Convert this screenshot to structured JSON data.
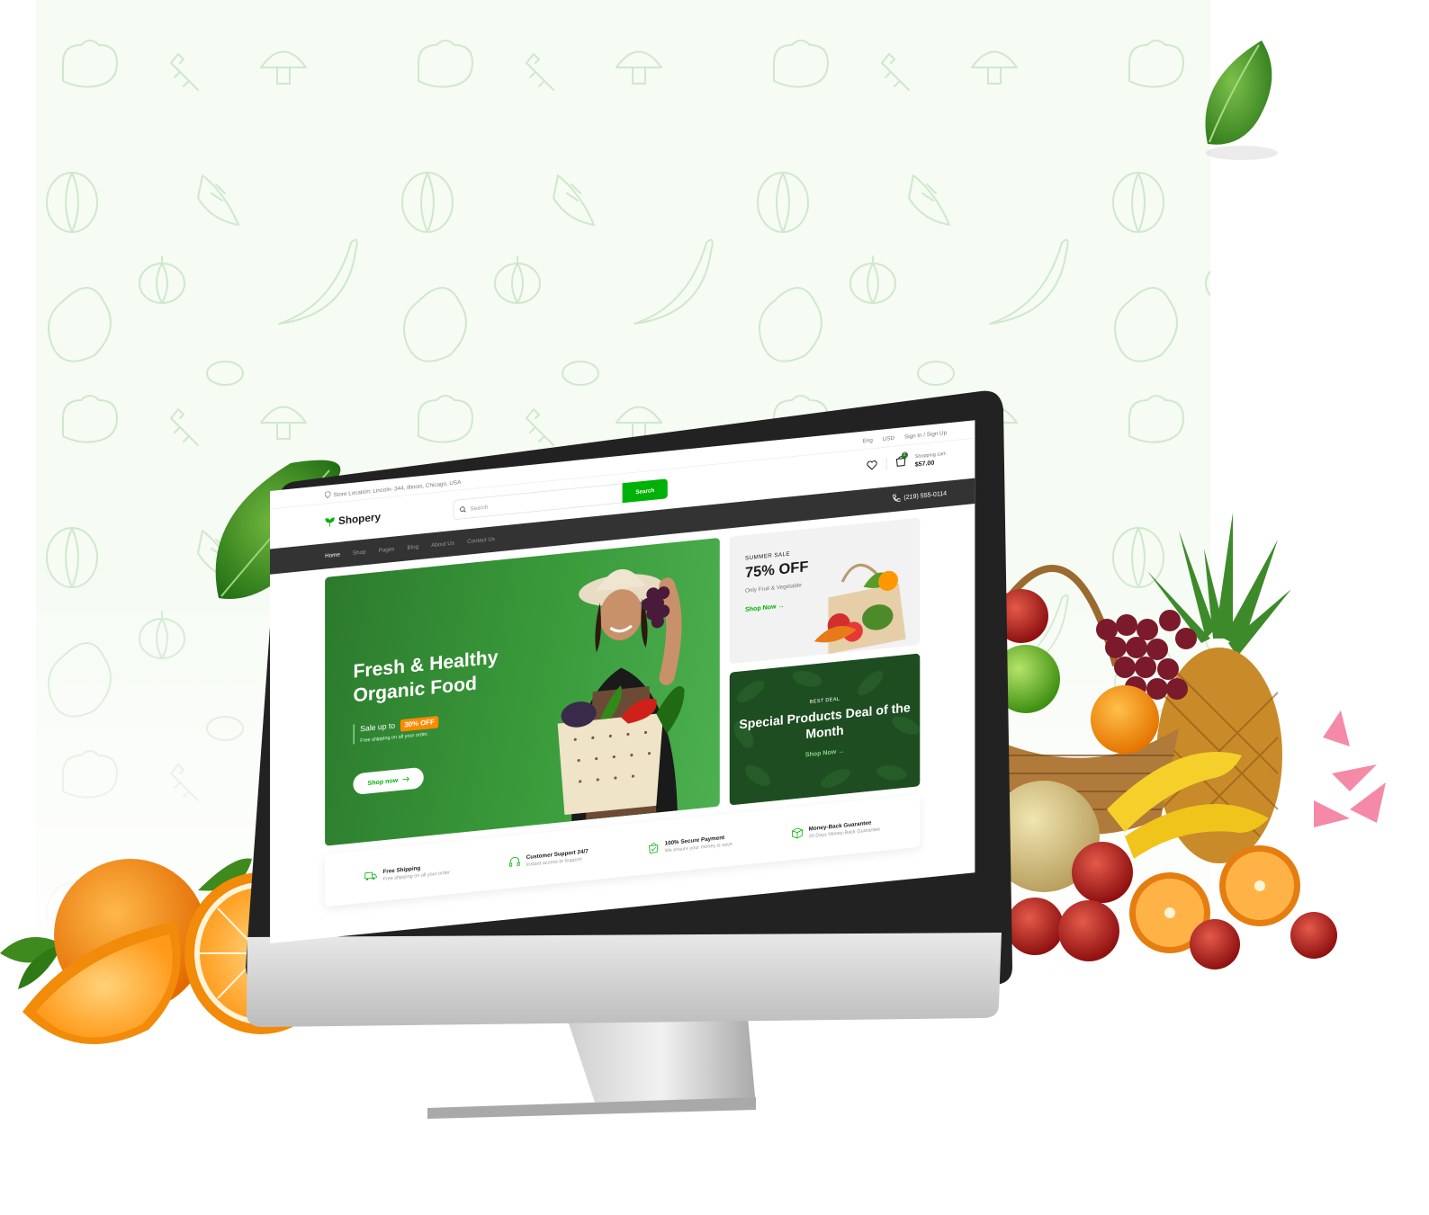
{
  "topbar": {
    "location": "Store Location: Lincoln- 344, Illinois, Chicago, USA",
    "language": "Eng",
    "currency": "USD",
    "auth": "Sign In / Sign Up"
  },
  "brand": {
    "name": "Shopery"
  },
  "search": {
    "placeholder": "Search",
    "button": "Search"
  },
  "cart": {
    "label": "Shopping cart:",
    "total": "$57.00",
    "count": "2"
  },
  "nav": {
    "items": [
      {
        "label": "Home"
      },
      {
        "label": "Shop"
      },
      {
        "label": "Pages"
      },
      {
        "label": "Blog"
      },
      {
        "label": "About Us"
      },
      {
        "label": "Contact Us"
      }
    ],
    "phone": "(219) 555-0114"
  },
  "hero": {
    "title": "Fresh & Healthy Organic Food",
    "sale_prefix": "Sale up to",
    "sale_badge": "30% OFF",
    "sale_sub": "Free shipping on all your order.",
    "cta": "Shop now"
  },
  "promo_summer": {
    "tag": "SUMMER SALE",
    "headline": "75% OFF",
    "sub": "Only Fruit & Vegetable",
    "cta": "Shop Now"
  },
  "promo_deal": {
    "tag": "BEST DEAL",
    "title": "Special Products Deal of the Month",
    "cta": "Shop Now"
  },
  "features": [
    {
      "title": "Free Shipping",
      "desc": "Free shipping on all your order",
      "icon": "truck-icon"
    },
    {
      "title": "Customer Support 24/7",
      "desc": "Instant access to Support",
      "icon": "headphones-icon"
    },
    {
      "title": "100% Secure Payment",
      "desc": "We ensure your money is save",
      "icon": "shopping-bag-icon"
    },
    {
      "title": "Money-Back Guarantee",
      "desc": "30 Days Money-Back Guarantee",
      "icon": "package-icon"
    }
  ],
  "colors": {
    "brand_green": "#00b207",
    "dark_nav": "#333333",
    "hero_green": "#3a9b3b",
    "badge_orange": "#ff8a00",
    "pattern_bg": "#f6fbf4"
  }
}
